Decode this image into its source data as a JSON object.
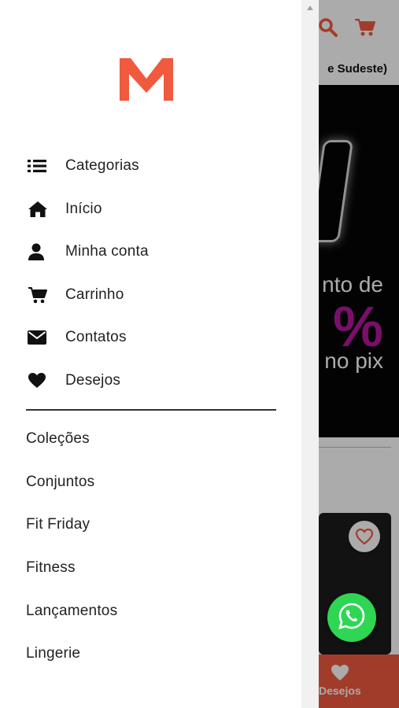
{
  "background": {
    "header_icons": [
      "search-icon",
      "cart-icon"
    ],
    "shipping_strip_text": "e Sudeste)",
    "banner": {
      "line1": "nto de",
      "line2": "%",
      "line3": "no pix",
      "accent_color": "#b5179e"
    },
    "bottom_nav": {
      "label": "Desejos",
      "icon": "heart-icon",
      "color": "#f05a3f"
    },
    "whatsapp_icon": "whatsapp-icon"
  },
  "drawer": {
    "logo": {
      "letter": "M",
      "color": "#f05a3f"
    },
    "menu": [
      {
        "icon": "list-icon",
        "label": "Categorias"
      },
      {
        "icon": "home-icon",
        "label": "Início"
      },
      {
        "icon": "user-icon",
        "label": "Minha conta"
      },
      {
        "icon": "cart-icon",
        "label": "Carrinho"
      },
      {
        "icon": "envelope-icon",
        "label": "Contatos"
      },
      {
        "icon": "heart-icon",
        "label": "Desejos"
      }
    ],
    "collections": [
      {
        "label": "Coleções"
      },
      {
        "label": "Conjuntos"
      },
      {
        "label": "Fit Friday"
      },
      {
        "label": "Fitness"
      },
      {
        "label": "Lançamentos"
      },
      {
        "label": "Lingerie"
      }
    ]
  }
}
